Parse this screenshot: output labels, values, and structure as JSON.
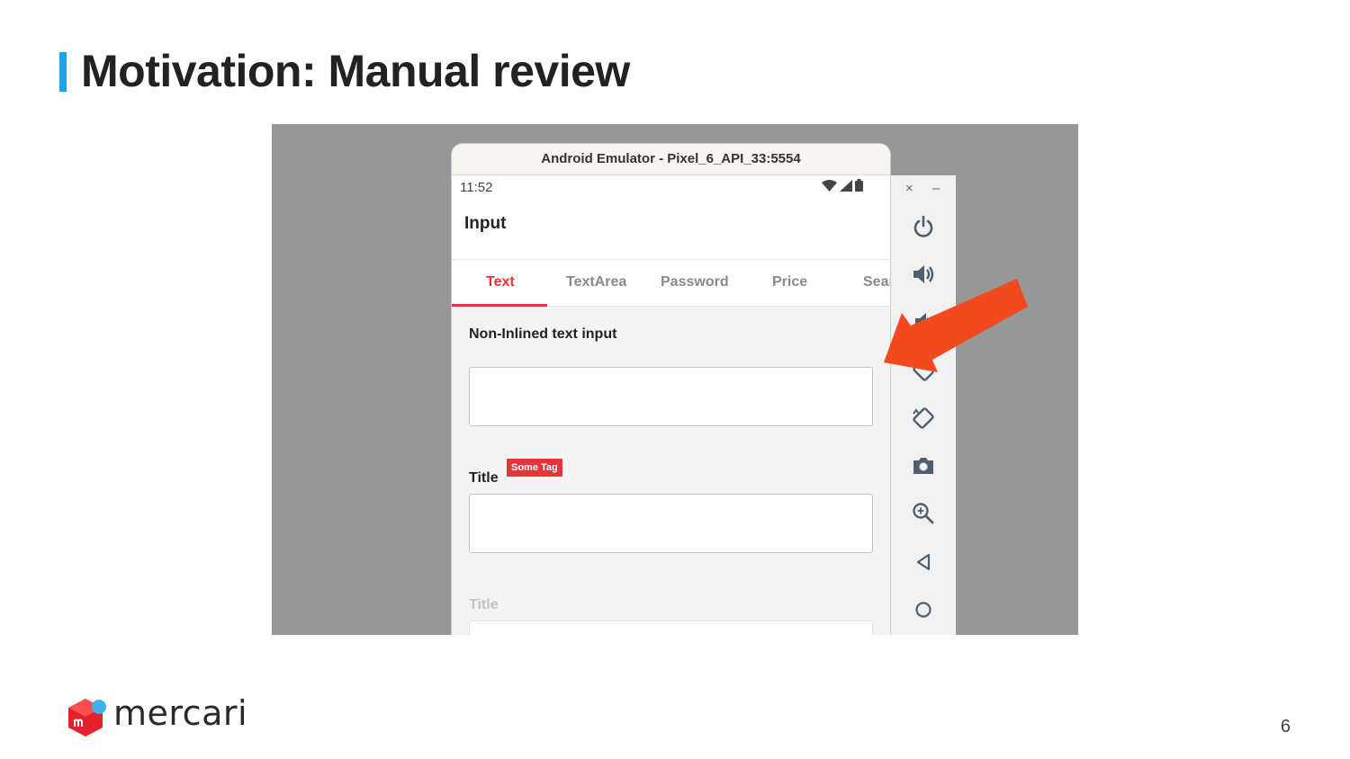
{
  "slide": {
    "title": "Motivation: Manual review",
    "page_number": "6",
    "brand": "mercari"
  },
  "emulator": {
    "window_title": "Android Emulator - Pixel_6_API_33:5554",
    "status_time": "11:52",
    "app_title": "Input",
    "tabs": [
      {
        "label": "Text",
        "active": true
      },
      {
        "label": "TextArea",
        "active": false
      },
      {
        "label": "Password",
        "active": false
      },
      {
        "label": "Price",
        "active": false
      },
      {
        "label": "Sear",
        "active": false
      }
    ],
    "fields": {
      "non_inlined_label": "Non-Inlined text input",
      "title_label": "Title",
      "tag_label": "Some Tag",
      "disabled_title_label": "Title"
    },
    "toolbar": {
      "close": "×",
      "minimize": "–",
      "icons": [
        "power-icon",
        "volume-up-icon",
        "volume-down-icon",
        "rotate-left-icon",
        "rotate-right-icon",
        "camera-icon",
        "zoom-icon",
        "back-icon",
        "home-icon"
      ]
    }
  },
  "colors": {
    "accent_blue": "#1aa6e4",
    "tab_red": "#e6343b",
    "arrow_red": "#f24a1f",
    "screenshot_bg": "#979797"
  }
}
